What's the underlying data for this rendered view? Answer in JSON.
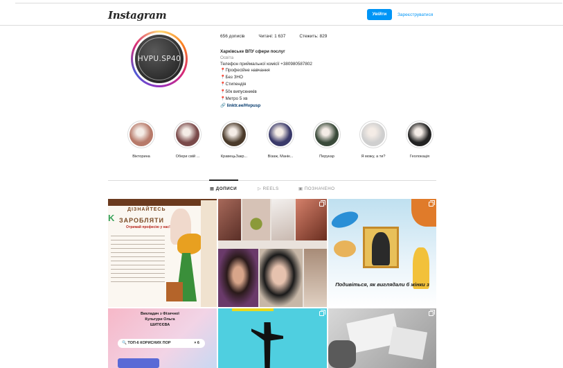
{
  "header": {
    "logo": "Instagram",
    "login_label": "Увійти",
    "signup_label": "Зареєструватися"
  },
  "profile": {
    "avatar_text": "HVPU.SP40",
    "stats": {
      "posts": "656 дописів",
      "followers": "Читачі: 1 637",
      "following": "Стежить: 829"
    },
    "bio": {
      "name": "Харківське ВПУ сфери послуг",
      "category": "Освіта",
      "phone": "Телефон приймальної комісії +380980587802",
      "lines": [
        "Професійне навчання",
        "Без ЗНО",
        "Стипендія",
        "50к випускників",
        "Метро 5 хв"
      ],
      "link": "linktr.ee/Hvpusp"
    }
  },
  "highlights": [
    {
      "label": "Вікторина",
      "color": "#b77a6a"
    },
    {
      "label": "Обери свій ...",
      "color": "#7a4a4a"
    },
    {
      "label": "КравецьЗакр...",
      "color": "#4a3a2a"
    },
    {
      "label": "Візаж, Манік...",
      "color": "#3a3a6a"
    },
    {
      "label": "Перукар",
      "color": "#3a4a3a"
    },
    {
      "label": "Я можу, а ти?",
      "color": "#cfcfcf"
    },
    {
      "label": "Геолокація",
      "color": "#222222"
    }
  ],
  "tabs": {
    "posts": "ДОПИСИ",
    "reels": "REELS",
    "tagged": "ПОЗНАЧЕНО"
  },
  "posts": [
    {
      "heading": "ДІЗНАЙТЕСЬ",
      "sub": "ЗАРОБЛЯТИ",
      "caption": "Отримай професію у нас!"
    },
    {
      "caption": ""
    },
    {
      "caption": "Подивіться, як виглядали б жінки з"
    },
    {
      "caption": "Викладач з Фізичної Культури Ольга ШИТЄЄВА",
      "search": "ТОП-6 КОРИСНИХ ПОР"
    },
    {
      "caption": ""
    },
    {
      "caption": ""
    }
  ]
}
